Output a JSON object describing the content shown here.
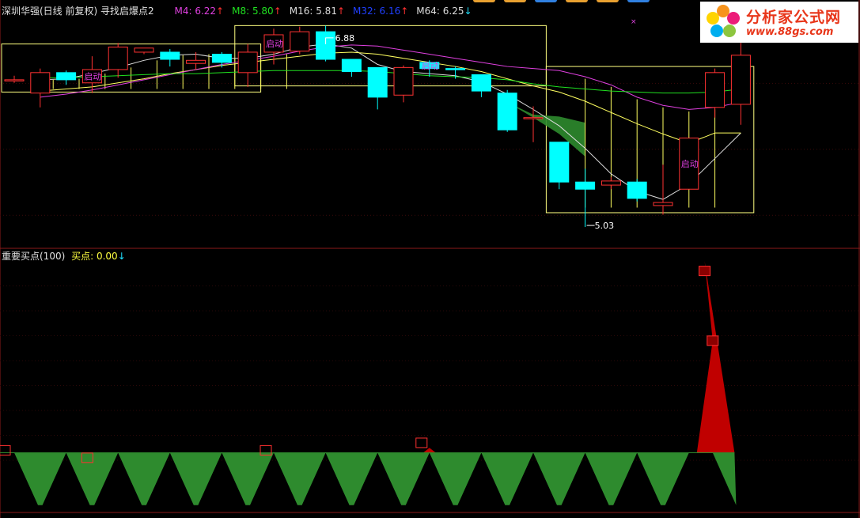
{
  "header": {
    "stock_title": "深圳华强(日线 前复权) 寻找启爆点2",
    "ma": [
      {
        "label": "M4: 6.22",
        "arrow": "↑",
        "color": "#e040e0"
      },
      {
        "label": "M8: 5.80",
        "arrow": "↑",
        "color": "#20e020"
      },
      {
        "label": "M16: 5.81",
        "arrow": "↑",
        "color": "#dddddd"
      },
      {
        "label": "M32: 6.16",
        "arrow": "↑",
        "color": "#2040ff"
      },
      {
        "label": "M64: 6.25",
        "arrow": "↓",
        "color": "#dddddd"
      }
    ],
    "arrow_up_color": "#ff3030",
    "arrow_down_color": "#20e0ff"
  },
  "sub_header": {
    "title": "重要买点(100)",
    "buy_label": "买点: 0.00",
    "buy_arrow": "↓"
  },
  "logo": {
    "title": "分析家公式网",
    "url": "www.88gs.com"
  },
  "annotations": {
    "high": "6.88",
    "low": "5.03",
    "start_label": "启动"
  },
  "colors": {
    "up": "#ff3232",
    "down": "#00ffff",
    "ma_white": "#dddddd",
    "ma_yellow": "#ffff60",
    "ma_magenta": "#e040e0",
    "ma_green": "#20e020",
    "box": "#ffff80",
    "fill_green": "#2e8b2e",
    "fill_red": "#c00000",
    "divider": "#8b1a1a"
  },
  "chart_data": [
    {
      "type": "candlestick",
      "title": "深圳华强(日线 前复权) 寻找启爆点2",
      "ylim": [
        4.93,
        7.08
      ],
      "candles": [
        {
          "o": 6.47,
          "c": 6.47,
          "h": 6.51,
          "l": 6.44
        },
        {
          "o": 6.34,
          "c": 6.54,
          "h": 6.58,
          "l": 6.2
        },
        {
          "o": 6.54,
          "c": 6.47,
          "h": 6.56,
          "l": 6.42
        },
        {
          "o": 6.44,
          "c": 6.57,
          "h": 6.7,
          "l": 6.34
        },
        {
          "o": 6.57,
          "c": 6.79,
          "h": 6.83,
          "l": 6.49
        },
        {
          "o": 6.74,
          "c": 6.78,
          "h": 6.78,
          "l": 6.72
        },
        {
          "o": 6.74,
          "c": 6.67,
          "h": 6.77,
          "l": 6.6
        },
        {
          "o": 6.63,
          "c": 6.66,
          "h": 6.74,
          "l": 6.57
        },
        {
          "o": 6.72,
          "c": 6.64,
          "h": 6.74,
          "l": 6.59
        },
        {
          "o": 6.54,
          "c": 6.74,
          "h": 6.82,
          "l": 6.4
        },
        {
          "o": 6.74,
          "c": 6.91,
          "h": 6.97,
          "l": 6.62
        },
        {
          "o": 6.75,
          "c": 6.94,
          "h": 6.99,
          "l": 6.72
        },
        {
          "o": 6.94,
          "c": 6.67,
          "h": 7.0,
          "l": 6.65
        },
        {
          "o": 6.67,
          "c": 6.55,
          "h": 6.67,
          "l": 6.5
        },
        {
          "o": 6.59,
          "c": 6.3,
          "h": 6.59,
          "l": 6.18
        },
        {
          "o": 6.32,
          "c": 6.59,
          "h": 6.61,
          "l": 6.25
        },
        {
          "o": 6.64,
          "c": 6.58,
          "h": 6.66,
          "l": 6.5
        },
        {
          "o": 6.58,
          "c": 6.57,
          "h": 6.6,
          "l": 6.48
        },
        {
          "o": 6.52,
          "c": 6.36,
          "h": 6.52,
          "l": 6.3
        },
        {
          "o": 6.34,
          "c": 5.98,
          "h": 6.37,
          "l": 5.96
        },
        {
          "o": 6.09,
          "c": 6.1,
          "h": 6.21,
          "l": 5.86
        },
        {
          "o": 5.86,
          "c": 5.47,
          "h": 5.86,
          "l": 5.4
        },
        {
          "o": 5.47,
          "c": 5.4,
          "h": 5.6,
          "l": 5.03
        },
        {
          "o": 5.44,
          "c": 5.48,
          "h": 5.52,
          "l": 5.4
        },
        {
          "o": 5.47,
          "c": 5.31,
          "h": 5.5,
          "l": 5.28
        },
        {
          "o": 5.24,
          "c": 5.27,
          "h": 5.64,
          "l": 5.15
        },
        {
          "o": 5.4,
          "c": 5.9,
          "h": 5.9,
          "l": 5.4
        },
        {
          "o": 6.2,
          "c": 6.54,
          "h": 6.58,
          "l": 6.1
        },
        {
          "o": 6.23,
          "c": 6.71,
          "h": 6.85,
          "l": 6.03
        }
      ],
      "ma_lines": [
        {
          "values": [
            null,
            6.47,
            6.48,
            6.53,
            6.59,
            6.66,
            6.71,
            6.72,
            6.68,
            6.68,
            6.72,
            6.79,
            6.82,
            6.78,
            6.62,
            6.55,
            6.53,
            6.51,
            6.45,
            6.33,
            6.18,
            6.02,
            5.8,
            5.55,
            5.38,
            5.3,
            5.45,
            5.7,
            5.95
          ]
        },
        {
          "values": [
            null,
            6.36,
            6.38,
            6.4,
            6.44,
            6.48,
            6.53,
            6.57,
            6.61,
            6.64,
            6.67,
            6.7,
            6.73,
            6.74,
            6.72,
            6.68,
            6.64,
            6.6,
            6.55,
            6.48,
            6.41,
            6.35,
            6.26,
            6.15,
            6.04,
            5.94,
            5.85,
            5.95,
            5.95
          ]
        },
        {
          "values": [
            null,
            6.3,
            6.33,
            6.37,
            6.42,
            6.47,
            6.52,
            6.57,
            6.62,
            6.66,
            6.7,
            6.75,
            6.79,
            6.81,
            6.8,
            6.76,
            6.72,
            6.68,
            6.64,
            6.6,
            6.58,
            6.56,
            6.5,
            6.42,
            6.3,
            6.22,
            6.18,
            6.2,
            6.25
          ]
        },
        {
          "values": [
            null,
            6.49,
            6.49,
            6.5,
            6.51,
            6.52,
            6.53,
            6.53,
            6.54,
            6.55,
            6.56,
            6.56,
            6.56,
            6.56,
            6.55,
            6.53,
            6.51,
            6.5,
            6.49,
            6.47,
            6.43,
            6.4,
            6.38,
            6.36,
            6.35,
            6.34,
            6.34,
            6.35,
            6.38
          ]
        }
      ],
      "boxes": [
        {
          "from": 0,
          "to": 10,
          "lo": 6.35,
          "hi": 6.82
        },
        {
          "from": 9,
          "to": 21,
          "lo": 6.41,
          "hi": 7.0
        },
        {
          "from": 21,
          "to": 29,
          "lo": 5.17,
          "hi": 6.6
        }
      ],
      "start_markers": [
        3,
        10,
        16,
        26
      ],
      "high_mark": {
        "index": 12,
        "value": 6.88
      },
      "low_mark": {
        "index": 22,
        "value": 5.03
      }
    },
    {
      "type": "area",
      "title": "重要买点(100)",
      "ylim": [
        0,
        100
      ],
      "levels": [
        20,
        30,
        40,
        50,
        60,
        70,
        80,
        90
      ],
      "baseline": 23,
      "values": [
        23,
        2,
        23,
        2,
        23,
        2,
        23,
        2,
        23,
        2,
        23,
        2,
        23,
        2,
        23,
        2,
        23,
        2,
        23,
        2,
        23,
        2,
        23,
        2,
        23,
        2,
        68,
        100,
        2
      ],
      "markers": [
        {
          "index": 0,
          "value": 24
        },
        {
          "index": 3,
          "value": 21
        },
        {
          "index": 10,
          "value": 24
        },
        {
          "index": 16,
          "value": 27
        },
        {
          "index": 26,
          "value": 68
        },
        {
          "index": 27,
          "value": 96
        }
      ]
    }
  ]
}
